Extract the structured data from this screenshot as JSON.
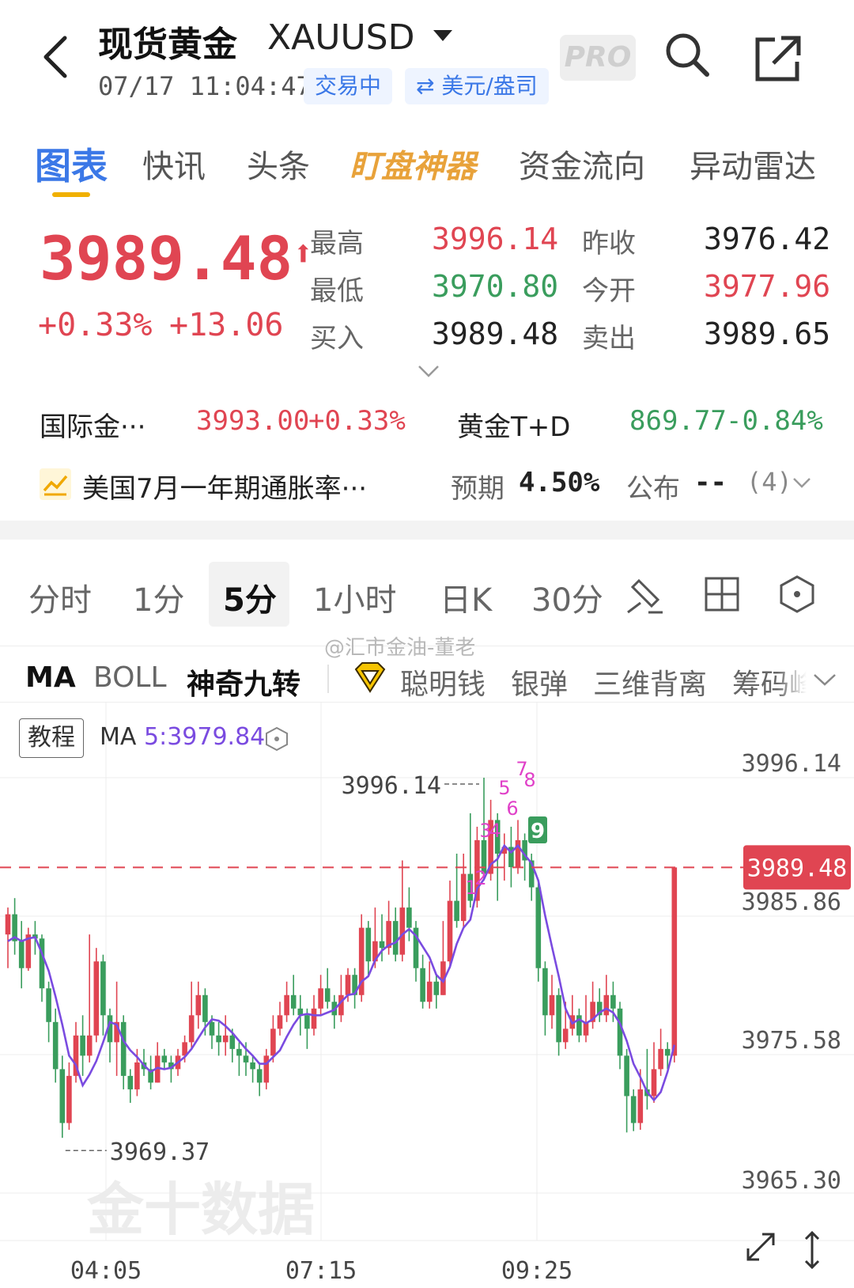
{
  "header": {
    "title": "现货黄金",
    "symbol": "XAUUSD",
    "datetime": "07/17 11:04:47",
    "status_chip": "交易中",
    "unit_chip": "⇄ 美元/盎司",
    "pro_label": "PRO"
  },
  "tabs": [
    "图表",
    "快讯",
    "头条",
    "盯盘神器",
    "资金流向",
    "异动雷达"
  ],
  "quote": {
    "price": "3989.48",
    "arrow": "⬆",
    "change_pct": "+0.33%",
    "change_abs": "+13.06",
    "high_label": "最高",
    "high": "3996.14",
    "low_label": "最低",
    "low": "3970.80",
    "bid_label": "买入",
    "bid": "3989.48",
    "prev_close_label": "昨收",
    "prev_close": "3976.42",
    "open_label": "今开",
    "open": "3977.96",
    "ask_label": "卖出",
    "ask": "3989.65"
  },
  "secondary": {
    "intl_name": "国际金···",
    "intl_price": "3993.00",
    "intl_pct": "+0.33%",
    "td_name": "黄金T+D",
    "td_price": "869.77",
    "td_pct": "-0.84%"
  },
  "event": {
    "title": "美国7月一年期通胀率···",
    "expected_label": "预期",
    "expected_value": "4.50%",
    "publish_label": "公布",
    "publish_value": "--",
    "count": "(4)"
  },
  "periods": [
    "分时",
    "1分",
    "5分",
    "1小时",
    "日K",
    "30分"
  ],
  "indicators": [
    "MA",
    "BOLL",
    "神奇九转",
    "聪明钱",
    "银弹",
    "三维背离",
    "筹码峰"
  ],
  "watermark_text": "@汇市金油-董老",
  "chart": {
    "tutorial_label": "教程",
    "ma_label": "MA",
    "ma_value": "5:3979.84",
    "brand_watermark": "金十数据",
    "high_marker": "3996.14",
    "low_marker": "3969.37",
    "current_price_tag": "3989.48"
  },
  "colors": {
    "up": "#e04552",
    "down": "#3a9d5d",
    "ma": "#7a4be0",
    "accent": "#3b78e7",
    "td_count": "#e040c8"
  },
  "chart_data": {
    "type": "candlestick",
    "y_ticks": [
      "3996.14",
      "3985.86",
      "3975.58",
      "3965.30"
    ],
    "x_ticks": [
      "04:05",
      "07:15",
      "09:25"
    ],
    "ylim": [
      3965.3,
      3996.14
    ],
    "current_price": 3989.48,
    "td_sequential_labels": [
      "1",
      "2",
      "3",
      "4",
      "5",
      "6",
      "7",
      "8",
      "9"
    ],
    "candles": [
      [
        3984.5,
        3986.0,
        3986.5,
        3982.0
      ],
      [
        3986.0,
        3984.0,
        3987.2,
        3983.0
      ],
      [
        3984.0,
        3982.0,
        3985.5,
        3980.5
      ],
      [
        3982.0,
        3984.5,
        3985.0,
        3981.8
      ],
      [
        3984.5,
        3984.2,
        3985.5,
        3983.0
      ],
      [
        3984.2,
        3980.5,
        3984.5,
        3979.5
      ],
      [
        3980.5,
        3978.0,
        3981.0,
        3976.5
      ],
      [
        3978.0,
        3974.5,
        3979.0,
        3973.5
      ],
      [
        3974.5,
        3970.5,
        3975.5,
        3969.4
      ],
      [
        3970.5,
        3974.0,
        3975.0,
        3970.0
      ],
      [
        3974.0,
        3977.0,
        3978.0,
        3973.5
      ],
      [
        3977.0,
        3975.5,
        3978.5,
        3974.0
      ],
      [
        3975.5,
        3977.0,
        3984.5,
        3975.0
      ],
      [
        3977.0,
        3982.5,
        3983.5,
        3976.5
      ],
      [
        3982.5,
        3978.5,
        3983.0,
        3977.0
      ],
      [
        3978.5,
        3976.5,
        3979.0,
        3975.0
      ],
      [
        3976.5,
        3978.0,
        3981.0,
        3974.0
      ],
      [
        3978.0,
        3974.0,
        3978.5,
        3973.0
      ],
      [
        3974.0,
        3973.0,
        3974.5,
        3972.0
      ],
      [
        3973.0,
        3975.0,
        3976.0,
        3972.5
      ],
      [
        3975.0,
        3974.5,
        3976.0,
        3974.0
      ],
      [
        3974.5,
        3973.5,
        3975.5,
        3973.0
      ],
      [
        3973.5,
        3975.5,
        3976.5,
        3973.5
      ],
      [
        3975.5,
        3975.0,
        3976.0,
        3974.5
      ],
      [
        3975.0,
        3974.5,
        3975.5,
        3973.5
      ],
      [
        3974.5,
        3975.5,
        3976.0,
        3974.0
      ],
      [
        3975.5,
        3976.5,
        3977.0,
        3975.0
      ],
      [
        3976.5,
        3978.5,
        3981.0,
        3976.0
      ],
      [
        3978.5,
        3980.0,
        3981.0,
        3977.5
      ],
      [
        3980.0,
        3978.0,
        3980.5,
        3977.0
      ],
      [
        3978.0,
        3977.0,
        3978.5,
        3976.0
      ],
      [
        3977.0,
        3976.5,
        3978.0,
        3975.5
      ],
      [
        3976.5,
        3977.0,
        3978.5,
        3975.5
      ],
      [
        3977.0,
        3976.0,
        3977.5,
        3975.0
      ],
      [
        3976.0,
        3975.5,
        3976.5,
        3974.0
      ],
      [
        3975.5,
        3975.0,
        3976.5,
        3974.0
      ],
      [
        3975.0,
        3974.5,
        3975.5,
        3973.5
      ],
      [
        3974.5,
        3973.5,
        3975.0,
        3972.5
      ],
      [
        3973.5,
        3975.5,
        3976.0,
        3973.0
      ],
      [
        3975.5,
        3977.5,
        3978.5,
        3975.0
      ],
      [
        3977.5,
        3978.5,
        3979.5,
        3977.0
      ],
      [
        3978.5,
        3980.0,
        3981.0,
        3978.0
      ],
      [
        3980.0,
        3979.0,
        3981.5,
        3978.5
      ],
      [
        3979.0,
        3978.5,
        3980.0,
        3977.0
      ],
      [
        3978.5,
        3977.5,
        3979.0,
        3976.0
      ],
      [
        3977.5,
        3979.0,
        3980.0,
        3977.0
      ],
      [
        3979.0,
        3980.5,
        3981.5,
        3978.5
      ],
      [
        3980.5,
        3979.5,
        3982.0,
        3979.0
      ],
      [
        3979.5,
        3978.5,
        3980.0,
        3977.5
      ],
      [
        3978.5,
        3980.0,
        3981.5,
        3978.0
      ],
      [
        3980.0,
        3981.5,
        3982.0,
        3979.5
      ],
      [
        3981.5,
        3980.0,
        3982.0,
        3979.0
      ],
      [
        3980.0,
        3985.0,
        3986.0,
        3979.5
      ],
      [
        3985.0,
        3982.5,
        3985.5,
        3981.5
      ],
      [
        3982.5,
        3984.0,
        3986.5,
        3982.0
      ],
      [
        3984.0,
        3983.5,
        3986.0,
        3982.5
      ],
      [
        3983.5,
        3985.5,
        3987.0,
        3983.0
      ],
      [
        3985.5,
        3983.0,
        3986.5,
        3982.5
      ],
      [
        3983.0,
        3986.5,
        3990.0,
        3982.5
      ],
      [
        3986.5,
        3985.0,
        3988.0,
        3984.0
      ],
      [
        3985.0,
        3982.0,
        3985.5,
        3981.0
      ],
      [
        3982.0,
        3979.5,
        3983.0,
        3979.0
      ],
      [
        3979.5,
        3981.0,
        3982.5,
        3979.0
      ],
      [
        3981.0,
        3980.0,
        3981.5,
        3979.0
      ],
      [
        3980.0,
        3982.5,
        3985.5,
        3980.0
      ],
      [
        3982.5,
        3987.0,
        3988.5,
        3982.0
      ],
      [
        3987.0,
        3985.5,
        3990.5,
        3985.0
      ],
      [
        3985.5,
        3989.0,
        3990.5,
        3985.0
      ],
      [
        3989.0,
        3987.0,
        3993.5,
        3986.5
      ],
      [
        3987.0,
        3991.5,
        3992.5,
        3986.5
      ],
      [
        3991.5,
        3989.0,
        3996.14,
        3988.5
      ],
      [
        3989.0,
        3993.0,
        3994.5,
        3988.5
      ],
      [
        3993.0,
        3990.5,
        3993.5,
        3987.0
      ],
      [
        3990.5,
        3991.0,
        3992.0,
        3988.5
      ],
      [
        3991.0,
        3989.5,
        3992.5,
        3988.0
      ],
      [
        3989.5,
        3991.5,
        3993.0,
        3989.0
      ],
      [
        3991.5,
        3990.0,
        3992.0,
        3988.5
      ],
      [
        3990.0,
        3988.0,
        3990.5,
        3987.0
      ],
      [
        3988.0,
        3982.0,
        3988.5,
        3981.0
      ],
      [
        3982.0,
        3978.5,
        3982.5,
        3977.0
      ],
      [
        3978.5,
        3980.0,
        3981.5,
        3977.5
      ],
      [
        3980.0,
        3976.5,
        3980.5,
        3975.5
      ],
      [
        3976.5,
        3977.5,
        3979.5,
        3976.0
      ],
      [
        3977.5,
        3978.5,
        3980.0,
        3977.0
      ],
      [
        3978.5,
        3977.0,
        3979.0,
        3976.5
      ],
      [
        3977.0,
        3978.0,
        3980.0,
        3976.5
      ],
      [
        3978.0,
        3979.5,
        3981.0,
        3977.5
      ],
      [
        3979.5,
        3978.5,
        3980.5,
        3978.0
      ],
      [
        3978.5,
        3980.0,
        3981.5,
        3978.0
      ],
      [
        3980.0,
        3979.0,
        3981.0,
        3978.0
      ],
      [
        3979.0,
        3975.5,
        3979.5,
        3974.5
      ],
      [
        3975.5,
        3972.5,
        3976.0,
        3969.8
      ],
      [
        3972.5,
        3970.5,
        3973.0,
        3969.9
      ],
      [
        3970.5,
        3973.0,
        3974.5,
        3970.0
      ],
      [
        3973.0,
        3972.5,
        3976.0,
        3971.5
      ],
      [
        3972.5,
        3974.5,
        3976.5,
        3972.0
      ],
      [
        3974.5,
        3976.0,
        3977.5,
        3974.0
      ],
      [
        3976.0,
        3975.5,
        3976.5,
        3974.5
      ],
      [
        3975.5,
        3989.48,
        3989.48,
        3975.0
      ]
    ],
    "ma5": [
      3984.0,
      3984.3,
      3984.0,
      3984.2,
      3984.3,
      3983.1,
      3981.8,
      3979.9,
      3977.8,
      3975.5,
      3974.8,
      3973.3,
      3974.1,
      3975.1,
      3976.5,
      3978.0,
      3977.8,
      3976.6,
      3975.9,
      3975.4,
      3974.8,
      3974.3,
      3974.6,
      3974.5,
      3974.6,
      3975.0,
      3975.4,
      3976.0,
      3976.8,
      3977.6,
      3978.2,
      3978.1,
      3977.7,
      3977.2,
      3976.6,
      3976.0,
      3975.5,
      3974.9,
      3974.9,
      3975.4,
      3975.9,
      3976.9,
      3977.8,
      3978.5,
      3978.6,
      3978.5,
      3978.5,
      3978.7,
      3978.9,
      3979.5,
      3980.0,
      3980.1,
      3981.0,
      3981.4,
      3982.6,
      3983.3,
      3983.7,
      3983.9,
      3984.5,
      3984.9,
      3984.4,
      3983.6,
      3982.8,
      3981.5,
      3981.0,
      3982.1,
      3983.8,
      3985.0,
      3985.6,
      3987.9,
      3988.6,
      3989.7,
      3990.1,
      3991.1,
      3990.6,
      3991.1,
      3990.4,
      3989.8,
      3988.5,
      3985.9,
      3983.6,
      3981.4,
      3979.0,
      3977.9,
      3978.2,
      3977.9,
      3978.2,
      3978.7,
      3979.0,
      3978.7,
      3977.9,
      3976.6,
      3974.9,
      3973.9,
      3972.8,
      3972.2,
      3972.8,
      3974.3,
      3976.3
    ]
  }
}
